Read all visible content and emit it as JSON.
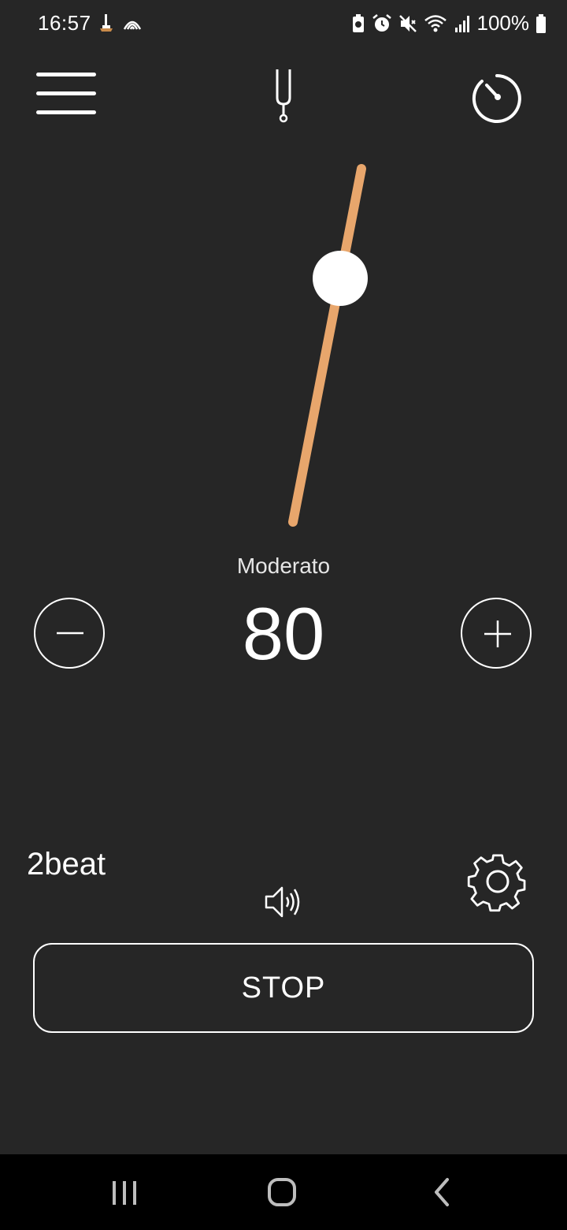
{
  "status_bar": {
    "time": "16:57",
    "battery": "100%",
    "icons": [
      "usb-debug-icon",
      "nfc-icon",
      "battery-saver-icon",
      "alarm-icon",
      "mute-icon",
      "wifi-icon",
      "signal-icon",
      "battery-icon"
    ]
  },
  "header": {
    "menu_icon": "hamburger-menu-icon",
    "tuner_icon": "tuning-fork-icon",
    "timer_icon": "stopwatch-icon"
  },
  "metronome": {
    "tempo_name": "Moderato",
    "bpm": "80",
    "pendulum_color": "#e8a66c"
  },
  "controls": {
    "beat_label": "2beat",
    "stop_label": "STOP",
    "sound_icon": "speaker-icon",
    "settings_icon": "gear-icon"
  },
  "nav": {
    "icons": [
      "recent-apps-icon",
      "home-icon",
      "back-icon"
    ]
  }
}
